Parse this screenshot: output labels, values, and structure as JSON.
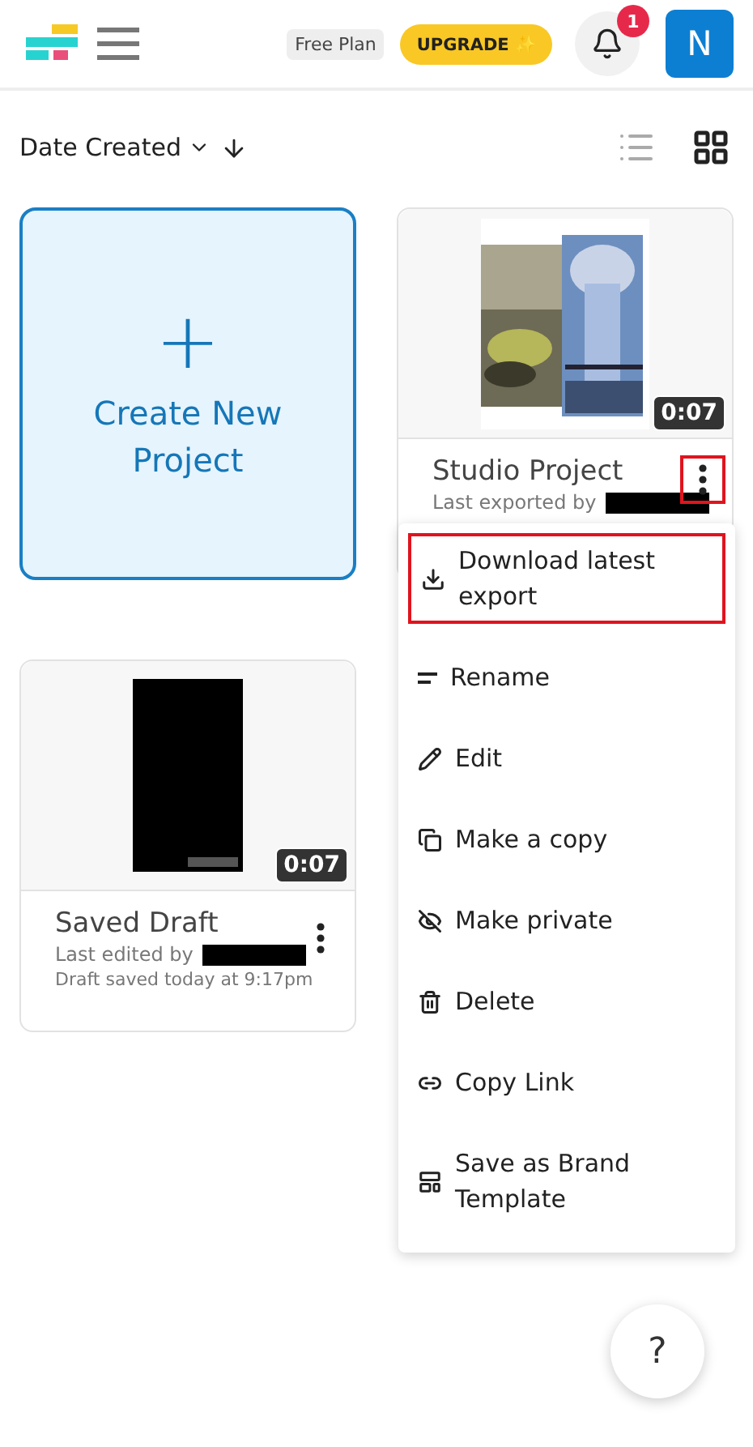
{
  "header": {
    "plan_badge": "Free Plan",
    "upgrade_button": "UPGRADE ✨",
    "notification_count": "1",
    "avatar_initial": "N"
  },
  "sort": {
    "label": "Date Created"
  },
  "views": [
    {
      "selected": false
    },
    {
      "selected": true
    }
  ],
  "create_card": {
    "plus": "+",
    "label": "Create New Project"
  },
  "projects": [
    {
      "kind": "studio",
      "title": "Studio Project",
      "subtitle": "Last exported by",
      "duration": "0:07",
      "menu_open": true,
      "highlighted": true
    },
    {
      "kind": "draft",
      "title": "Saved Draft",
      "subtitle": "Last edited by",
      "detail": "Draft saved today at 9:17pm",
      "duration": "0:07",
      "menu_open": false,
      "highlighted": false
    }
  ],
  "menu": [
    {
      "label": "Download latest export",
      "highlighted": true
    },
    {
      "label": "Rename",
      "highlighted": false
    },
    {
      "label": "Edit",
      "highlighted": false
    },
    {
      "label": "Make a copy",
      "highlighted": false
    },
    {
      "label": "Make private",
      "highlighted": false
    },
    {
      "label": "Delete",
      "highlighted": false
    },
    {
      "label": "Copy Link",
      "highlighted": false
    },
    {
      "label": "Save as Brand Template",
      "highlighted": false
    }
  ],
  "help_button": "?"
}
